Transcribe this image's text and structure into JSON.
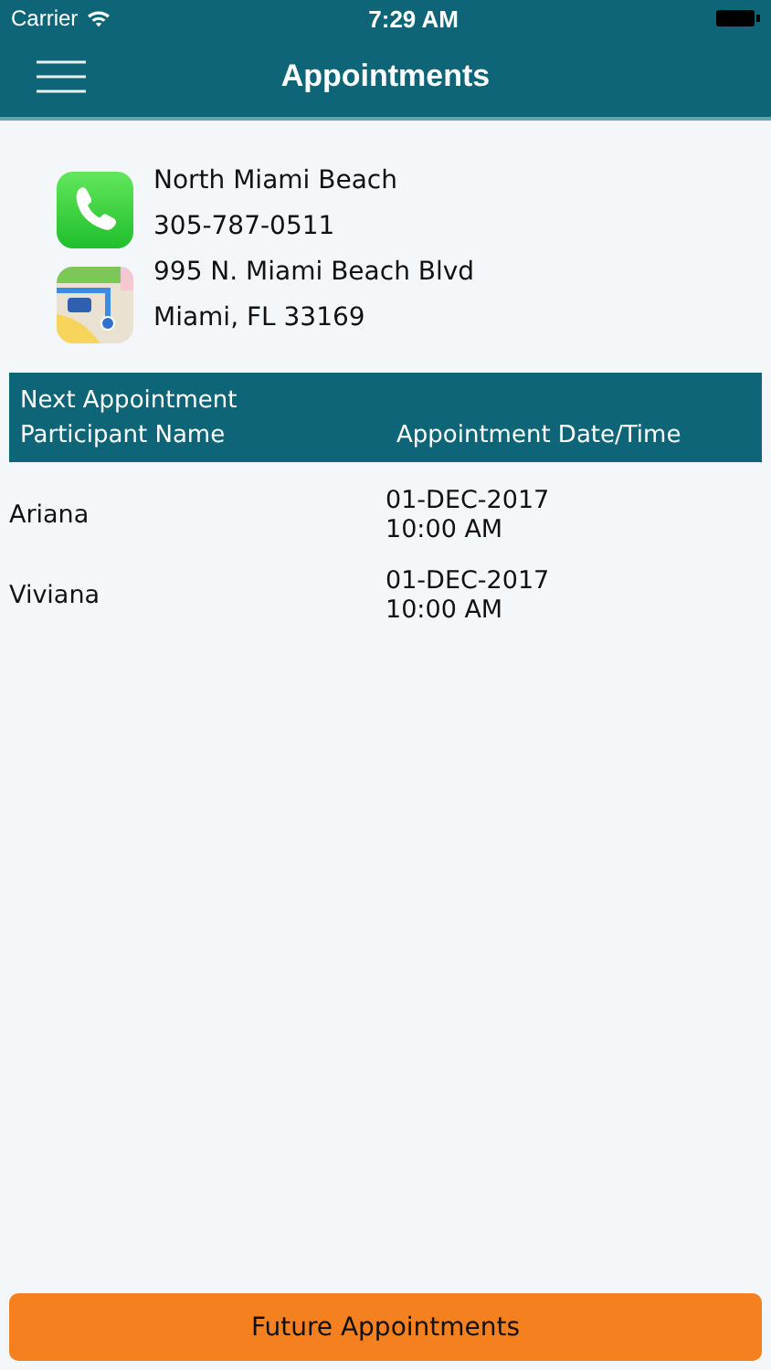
{
  "status_bar": {
    "carrier": "Carrier",
    "time": "7:29 AM"
  },
  "nav_bar": {
    "title": "Appointments"
  },
  "contact": {
    "name": "North Miami Beach",
    "phone": "305-787-0511",
    "address_line1": "995 N. Miami Beach Blvd",
    "address_line2": "Miami, FL 33169"
  },
  "table": {
    "title": "Next Appointment",
    "columns": [
      "Participant Name",
      "Appointment Date/Time"
    ],
    "rows": [
      {
        "name": "Ariana",
        "date": "01-DEC-2017",
        "time": "10:00 AM"
      },
      {
        "name": "Viviana",
        "date": "01-DEC-2017",
        "time": "10:00 AM"
      }
    ]
  },
  "footer_button": "Future Appointments"
}
